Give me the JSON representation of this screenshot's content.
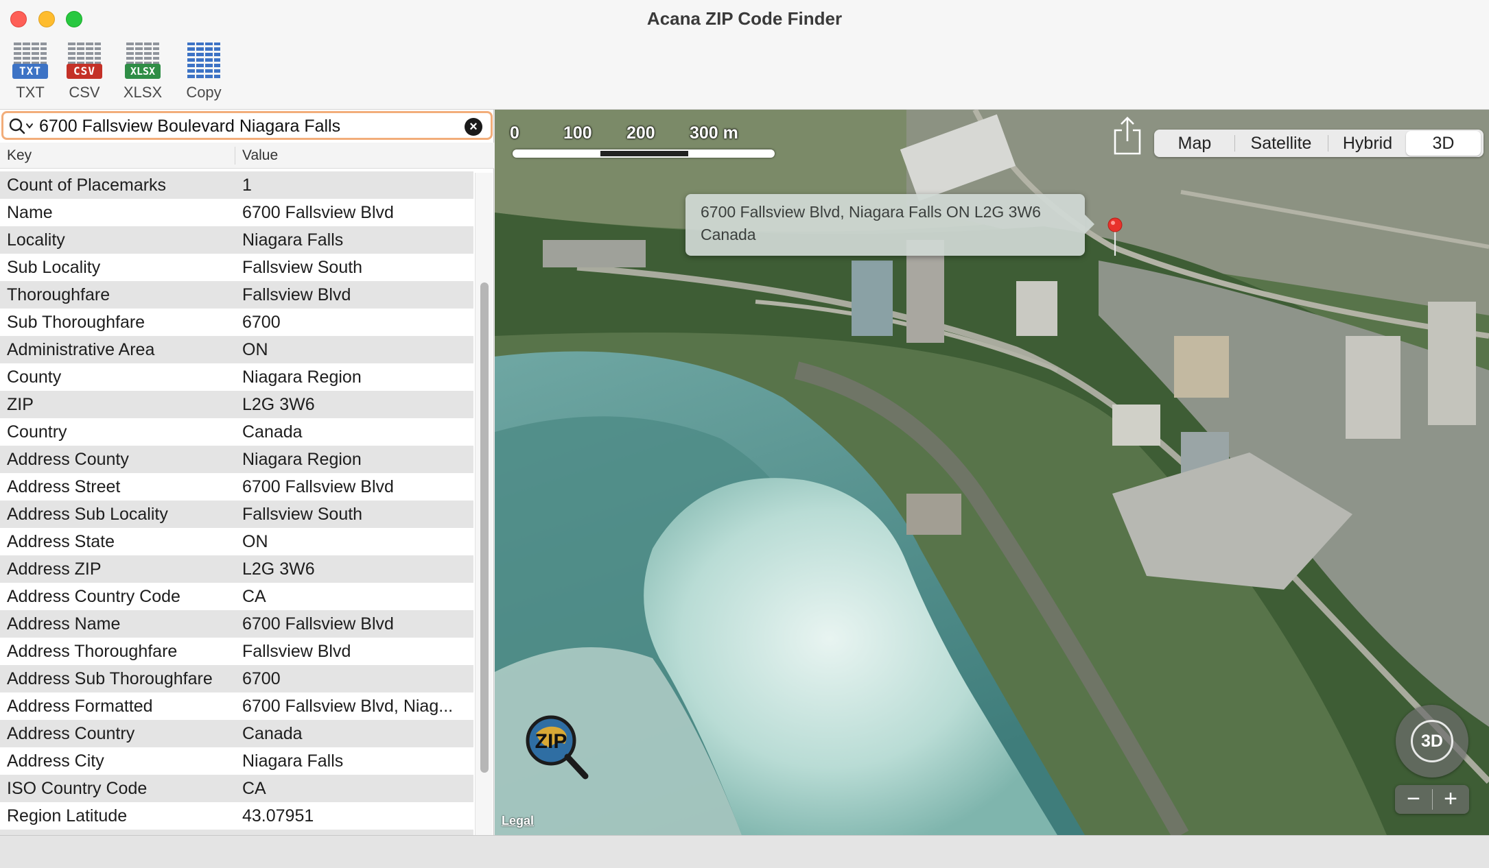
{
  "window": {
    "title": "Acana ZIP Code Finder"
  },
  "toolbar": {
    "items": [
      {
        "badge": "TXT",
        "label": "TXT"
      },
      {
        "badge": "CSV",
        "label": "CSV"
      },
      {
        "badge": "XLSX",
        "label": "XLSX"
      },
      {
        "badge": "",
        "label": "Copy"
      }
    ]
  },
  "search": {
    "value": "6700 Fallsview Boulevard Niagara Falls",
    "clear_label": "×"
  },
  "table": {
    "columns": [
      "Key",
      "Value"
    ],
    "rows": [
      {
        "key": "Count of Placemarks",
        "value": "1"
      },
      {
        "key": "Name",
        "value": "6700 Fallsview Blvd"
      },
      {
        "key": "Locality",
        "value": "Niagara Falls"
      },
      {
        "key": "Sub Locality",
        "value": "Fallsview South"
      },
      {
        "key": "Thoroughfare",
        "value": "Fallsview Blvd"
      },
      {
        "key": "Sub Thoroughfare",
        "value": "6700"
      },
      {
        "key": "Administrative Area",
        "value": "ON"
      },
      {
        "key": "County",
        "value": "Niagara Region"
      },
      {
        "key": "ZIP",
        "value": "L2G 3W6"
      },
      {
        "key": "Country",
        "value": "Canada"
      },
      {
        "key": "Address County",
        "value": "Niagara Region"
      },
      {
        "key": "Address Street",
        "value": "6700 Fallsview Blvd"
      },
      {
        "key": "Address Sub Locality",
        "value": "Fallsview South"
      },
      {
        "key": "Address State",
        "value": "ON"
      },
      {
        "key": "Address ZIP",
        "value": "L2G 3W6"
      },
      {
        "key": "Address Country Code",
        "value": "CA"
      },
      {
        "key": "Address Name",
        "value": "6700 Fallsview Blvd"
      },
      {
        "key": "Address Thoroughfare",
        "value": "Fallsview Blvd"
      },
      {
        "key": "Address Sub Thoroughfare",
        "value": "6700"
      },
      {
        "key": "Address Formatted",
        "value": "6700 Fallsview Blvd, Niag..."
      },
      {
        "key": "Address Country",
        "value": "Canada"
      },
      {
        "key": "Address City",
        "value": "Niagara Falls"
      },
      {
        "key": "ISO Country Code",
        "value": "CA"
      },
      {
        "key": "Region Latitude",
        "value": "43.07951"
      },
      {
        "key": "",
        "value": ""
      }
    ]
  },
  "map": {
    "scale_labels": [
      "0",
      "100",
      "200",
      "300 m"
    ],
    "modes": [
      "Map",
      "Satellite",
      "Hybrid",
      "3D"
    ],
    "selected_mode": "3D",
    "callout": {
      "line1": "6700 Fallsview Blvd, Niagara Falls ON L2G 3W6",
      "line2": "Canada"
    },
    "logo_text": "ZIP",
    "legal": "Legal",
    "compass_label": "3D",
    "zoom_out": "−",
    "zoom_in": "+"
  },
  "colors": {
    "pin": "#e8322b",
    "search_focus": "#f2ad7a",
    "water": "#5a9c98"
  }
}
